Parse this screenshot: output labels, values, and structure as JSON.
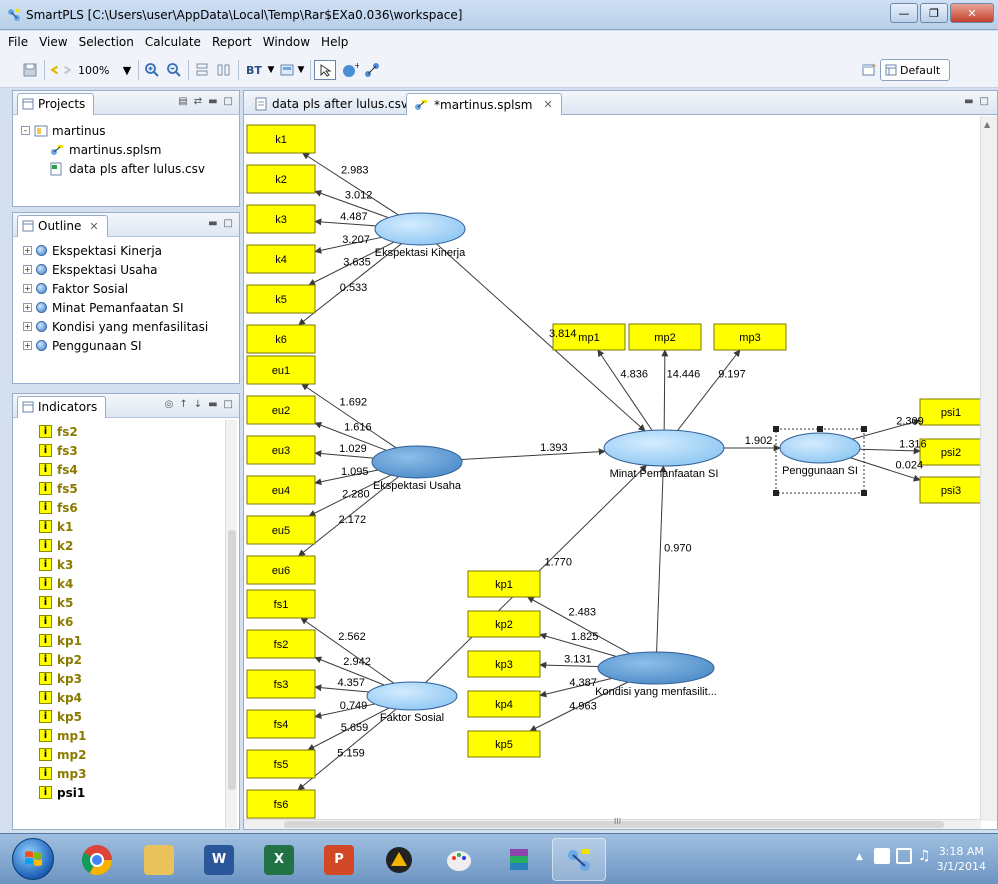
{
  "window": {
    "title": "SmartPLS [C:\\Users\\user\\AppData\\Local\\Temp\\Rar$EXa0.036\\workspace]"
  },
  "menu": [
    "File",
    "View",
    "Selection",
    "Calculate",
    "Report",
    "Window",
    "Help"
  ],
  "toolbar": {
    "zoom": "100%",
    "bt_label": "BT",
    "perspective": "Default"
  },
  "projects": {
    "tab": "Projects",
    "root": "martinus",
    "children": [
      "martinus.splsm",
      "data pls after lulus.csv"
    ]
  },
  "outline": {
    "tab": "Outline",
    "items": [
      "Ekspektasi Kinerja",
      "Ekspektasi Usaha",
      "Faktor Sosial",
      "Minat Pemanfaatan SI",
      "Kondisi yang menfasilitasi",
      "Penggunaan SI"
    ]
  },
  "indicators": {
    "tab": "Indicators",
    "items": [
      "fs2",
      "fs3",
      "fs4",
      "fs5",
      "fs6",
      "k1",
      "k2",
      "k3",
      "k4",
      "k5",
      "k6",
      "kp1",
      "kp2",
      "kp3",
      "kp4",
      "kp5",
      "mp1",
      "mp2",
      "mp3",
      "psi1"
    ]
  },
  "editor": {
    "tabs": [
      "data pls after lulus.csv",
      "*martinus.splsm"
    ],
    "scroll_marker": "III"
  },
  "colors": {
    "indicator": "#ffff00",
    "latent_light": "#9ecff5",
    "latent_dark": "#5b96cf",
    "arrow": "#3a3a3a"
  },
  "model": {
    "latents": [
      {
        "id": "ek",
        "label": "Ekspektasi Kinerja",
        "shade": "light"
      },
      {
        "id": "eu",
        "label": "Ekspektasi Usaha",
        "shade": "dark"
      },
      {
        "id": "fs",
        "label": "Faktor Sosial",
        "shade": "light"
      },
      {
        "id": "mp",
        "label": "Minat Pemanfaatan SI",
        "shade": "light"
      },
      {
        "id": "kp",
        "label": "Kondisi yang menfasilit...",
        "shade": "dark"
      },
      {
        "id": "psi",
        "label": "Penggunaan SI",
        "shade": "light"
      }
    ],
    "indicators": [
      "k1",
      "k2",
      "k3",
      "k4",
      "k5",
      "k6",
      "eu1",
      "eu2",
      "eu3",
      "eu4",
      "eu5",
      "eu6",
      "fs1",
      "fs2",
      "fs3",
      "fs4",
      "fs5",
      "fs6",
      "mp1",
      "mp2",
      "mp3",
      "kp1",
      "kp2",
      "kp3",
      "kp4",
      "kp5",
      "psi1",
      "psi2",
      "psi3"
    ],
    "loadings": [
      {
        "from": "ek",
        "to": "k1",
        "value": "2.983"
      },
      {
        "from": "ek",
        "to": "k2",
        "value": "3.012"
      },
      {
        "from": "ek",
        "to": "k3",
        "value": "4.487"
      },
      {
        "from": "ek",
        "to": "k4",
        "value": "3.207"
      },
      {
        "from": "ek",
        "to": "k5",
        "value": "3.635"
      },
      {
        "from": "ek",
        "to": "k6",
        "value": "0.533"
      },
      {
        "from": "eu",
        "to": "eu1",
        "value": "1.692"
      },
      {
        "from": "eu",
        "to": "eu2",
        "value": "1.616"
      },
      {
        "from": "eu",
        "to": "eu3",
        "value": "1.029"
      },
      {
        "from": "eu",
        "to": "eu4",
        "value": "1.095"
      },
      {
        "from": "eu",
        "to": "eu5",
        "value": "2.280"
      },
      {
        "from": "eu",
        "to": "eu6",
        "value": "2.172"
      },
      {
        "from": "fs",
        "to": "fs1",
        "value": "2.562"
      },
      {
        "from": "fs",
        "to": "fs2",
        "value": "2.942"
      },
      {
        "from": "fs",
        "to": "fs3",
        "value": "4.357"
      },
      {
        "from": "fs",
        "to": "fs4",
        "value": "0.749"
      },
      {
        "from": "fs",
        "to": "fs5",
        "value": "5.659"
      },
      {
        "from": "fs",
        "to": "fs6",
        "value": "5.159"
      },
      {
        "from": "mp",
        "to": "mp1",
        "value": "4.836"
      },
      {
        "from": "mp",
        "to": "mp2",
        "value": "14.446"
      },
      {
        "from": "mp",
        "to": "mp3",
        "value": "9.197"
      },
      {
        "from": "kp",
        "to": "kp1",
        "value": "2.483"
      },
      {
        "from": "kp",
        "to": "kp2",
        "value": "1.825"
      },
      {
        "from": "kp",
        "to": "kp3",
        "value": "3.131"
      },
      {
        "from": "kp",
        "to": "kp4",
        "value": "4.387"
      },
      {
        "from": "kp",
        "to": "kp5",
        "value": "4.963"
      },
      {
        "from": "psi",
        "to": "psi1",
        "value": "2.309"
      },
      {
        "from": "psi",
        "to": "psi2",
        "value": "1.316"
      },
      {
        "from": "psi",
        "to": "psi3",
        "value": "0.024"
      }
    ],
    "paths": [
      {
        "from": "ek",
        "to": "mp",
        "value": "3.814"
      },
      {
        "from": "eu",
        "to": "mp",
        "value": "1.393"
      },
      {
        "from": "fs",
        "to": "mp",
        "value": "1.770"
      },
      {
        "from": "kp",
        "to": "mp",
        "value": "0.970"
      },
      {
        "from": "mp",
        "to": "psi",
        "value": "1.902"
      }
    ]
  },
  "taskbar": {
    "time": "3:18 AM",
    "date": "3/1/2014"
  }
}
